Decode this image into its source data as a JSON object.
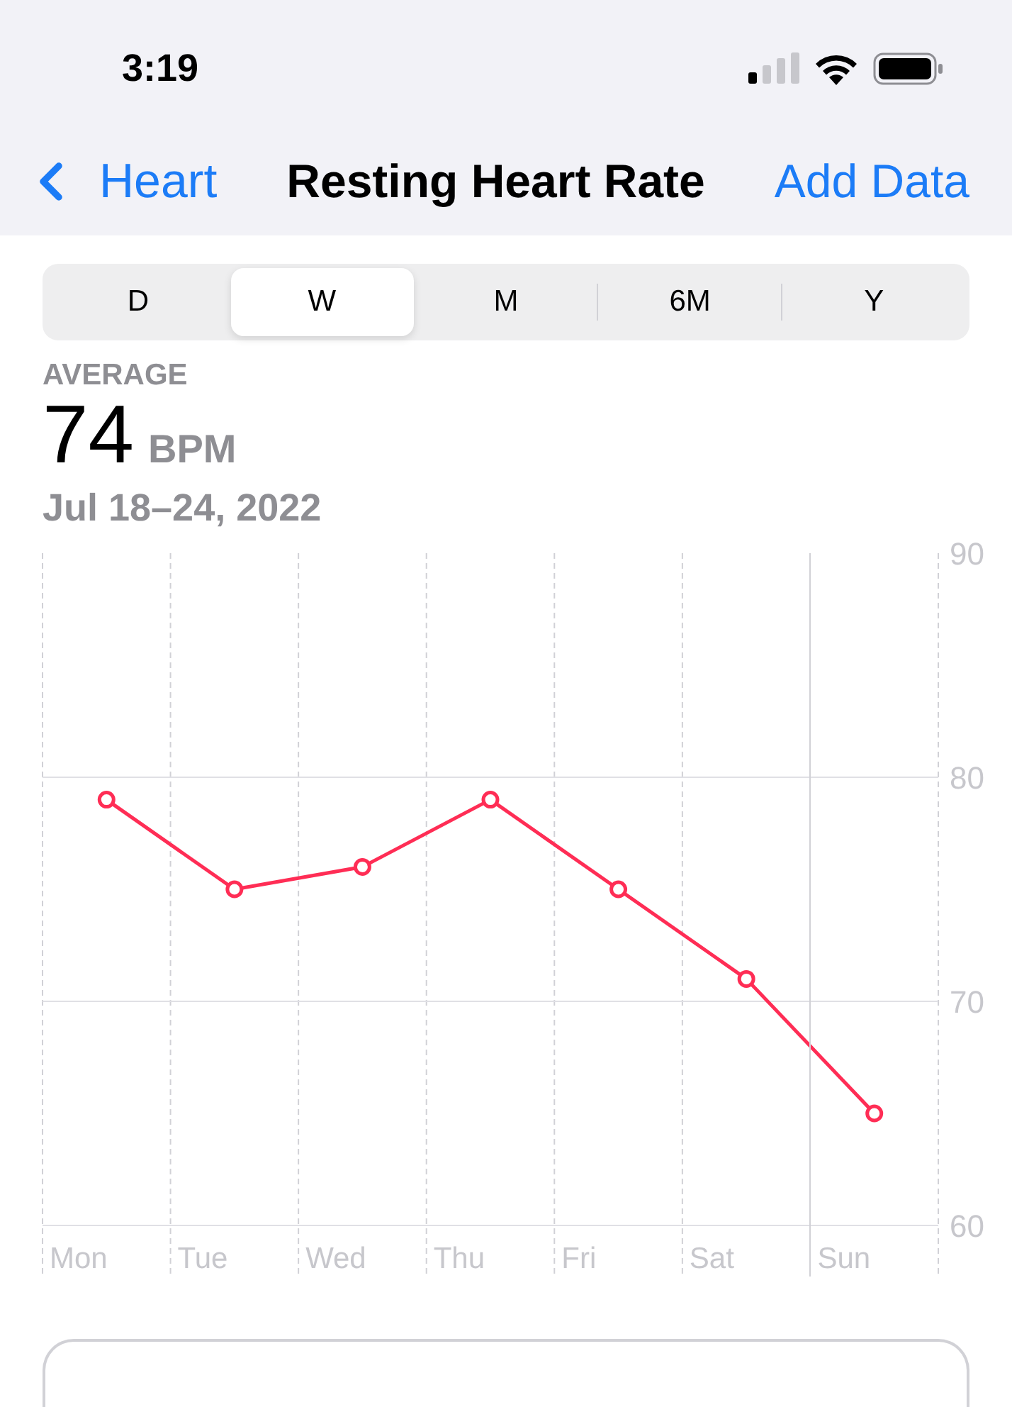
{
  "status_bar": {
    "time": "3:19"
  },
  "nav": {
    "back": "Heart",
    "title": "Resting Heart Rate",
    "action": "Add Data"
  },
  "segments": [
    {
      "label": "D",
      "selected": false
    },
    {
      "label": "W",
      "selected": true
    },
    {
      "label": "M",
      "selected": false
    },
    {
      "label": "6M",
      "selected": false
    },
    {
      "label": "Y",
      "selected": false
    }
  ],
  "summary": {
    "label": "AVERAGE",
    "value": "74",
    "unit": "BPM",
    "range": "Jul 18–24, 2022"
  },
  "chart": {
    "chart_data": {
      "type": "line",
      "categories": [
        "Mon",
        "Tue",
        "Wed",
        "Thu",
        "Fri",
        "Sat",
        "Sun"
      ],
      "series": [
        {
          "color": "#ff2d55",
          "marker": "circle",
          "values": [
            79,
            75,
            76,
            79,
            75,
            71,
            65
          ]
        }
      ],
      "ylim": [
        60,
        90
      ],
      "yticks": [
        60,
        70,
        80,
        90
      ]
    }
  }
}
